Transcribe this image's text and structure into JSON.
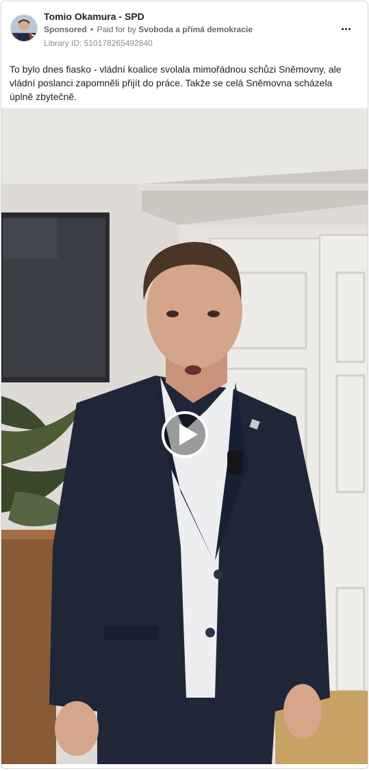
{
  "ad": {
    "page_name": "Tomio Okamura - SPD",
    "sponsored_label": "Sponsored",
    "separator": "•",
    "paid_for_prefix": "Paid for by",
    "payer": "Svoboda a přímá demokracie",
    "library_id": "Library ID: 510178265492840",
    "body_text": "To bylo dnes fiasko - vládní koalice svolala mimořádnou schůzi Sněmovny, ale vládní poslanci zapomněli přijít do práce. Takže se celá Sněmovna scházela úplně zbytečně."
  },
  "icons": {
    "more": "more-options-icon",
    "play": "play-icon"
  },
  "colors": {
    "text_primary": "#1c1e21",
    "text_secondary": "#606770",
    "card_border": "#cfd3d8"
  }
}
